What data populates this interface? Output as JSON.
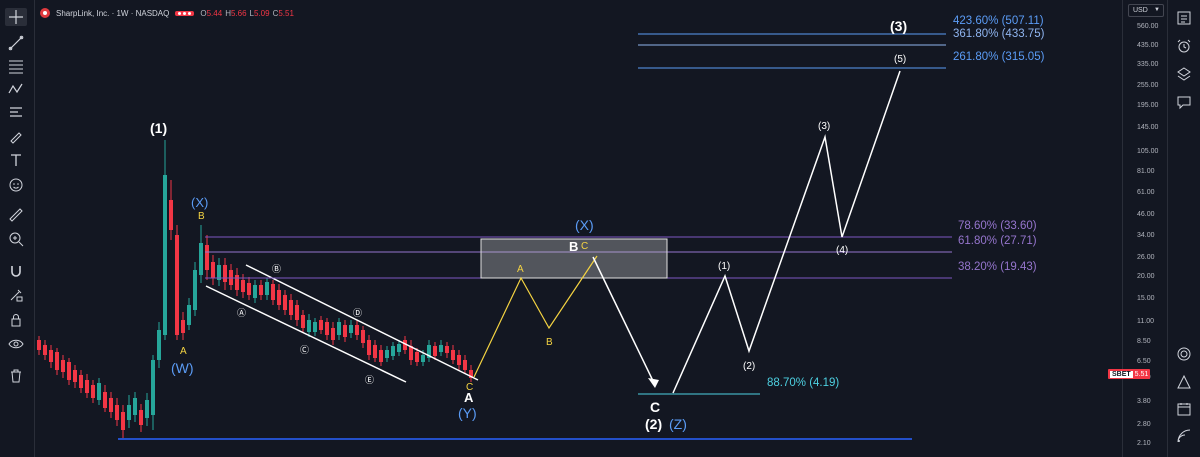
{
  "header": {
    "symbol_title": "SharpLink, Inc. · 1W · NASDAQ",
    "open_label": "O",
    "open_value": "5.44",
    "high_label": "H",
    "high_value": "5.66",
    "low_label": "L",
    "low_value": "5.09",
    "close_label": "C",
    "close_value": "5.51"
  },
  "price_axis": {
    "currency": "USD",
    "ticks": [
      "560.00",
      "435.00",
      "335.00",
      "255.00",
      "195.00",
      "145.00",
      "105.00",
      "81.00",
      "61.00",
      "46.00",
      "34.00",
      "26.00",
      "20.00",
      "15.00",
      "11.00",
      "8.50",
      "6.50",
      "5.00",
      "3.80",
      "2.80",
      "2.10"
    ],
    "last_price_ticker": "SBET",
    "last_price": "5.51"
  },
  "fib_levels": {
    "f4236": "423.60% (507.11)",
    "f3618": "361.80% (433.75)",
    "f2618": "261.80% (315.05)",
    "f786": "78.60% (33.60)",
    "f618": "61.80% (27.71)",
    "f382": "38.20% (19.43)",
    "f887": "88.70% (4.19)"
  },
  "wave_labels": {
    "w1": "(1)",
    "X_top": "(X)",
    "B_small": "B",
    "A_small": "A",
    "W": "(W)",
    "circ_A": "Ⓐ",
    "circ_B": "Ⓑ",
    "circ_C": "Ⓒ",
    "circ_D": "Ⓓ",
    "circ_E": "Ⓔ",
    "C_small": "C",
    "A_white": "A",
    "Y": "(Y)",
    "X_mid": "(X)",
    "B_white": "B",
    "C_yellow_box": "C",
    "A_yellow": "A",
    "B_yellow": "B",
    "C_bottom": "C",
    "w2": "(2)",
    "Z": "(Z)",
    "sub1": "(1)",
    "sub2": "(2)",
    "sub3": "(3)",
    "sub4": "(4)",
    "sub5": "(5)",
    "w3": "(3)"
  },
  "colors": {
    "up": "#26a69a",
    "down": "#f23645",
    "fib_blue": "#5b9cf6",
    "fib_purple": "#b39ddb",
    "yellow": "#f5d442",
    "white": "#ffffff",
    "cyan": "#4dd0e1"
  }
}
